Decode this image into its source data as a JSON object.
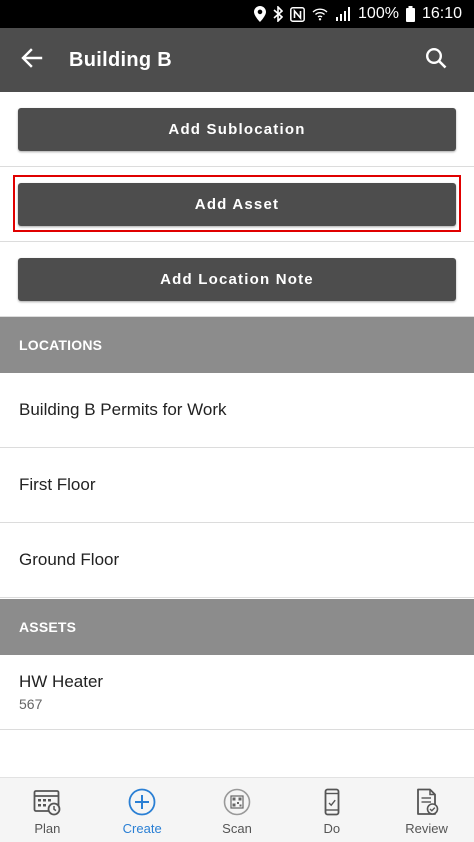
{
  "status_bar": {
    "battery": "100%",
    "time": "16:10"
  },
  "app_bar": {
    "title": "Building B"
  },
  "actions": {
    "add_sublocation": "Add Sublocation",
    "add_asset": "Add Asset",
    "add_location_note": "Add Location Note"
  },
  "locations": {
    "header": "LOCATIONS",
    "items": [
      {
        "label": "Building B Permits for Work"
      },
      {
        "label": "First Floor"
      },
      {
        "label": "Ground Floor"
      }
    ]
  },
  "assets": {
    "header": "ASSETS",
    "items": [
      {
        "name": "HW Heater",
        "id": "567"
      }
    ]
  },
  "bottom_nav": {
    "items": [
      {
        "label": "Plan",
        "icon": "calendar-clock-icon"
      },
      {
        "label": "Create",
        "icon": "plus-circle-icon"
      },
      {
        "label": "Scan",
        "icon": "qr-scan-icon"
      },
      {
        "label": "Do",
        "icon": "phone-icon"
      },
      {
        "label": "Review",
        "icon": "document-check-icon"
      }
    ],
    "active": "Create"
  },
  "colors": {
    "app_bar": "#4d4d4d",
    "section_header": "#8c8c8c",
    "accent": "#2a7fd4",
    "highlight": "#e00000"
  }
}
